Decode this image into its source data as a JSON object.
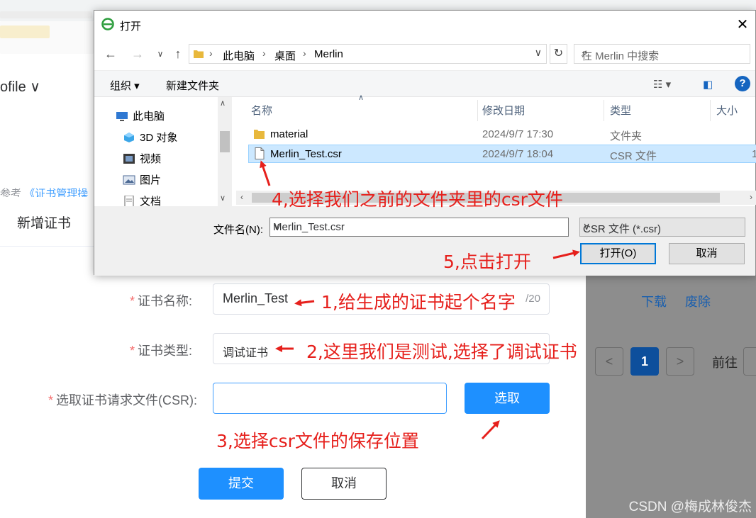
{
  "background": {
    "profile_menu": "ofile ∨",
    "breadcrumb_prefix": "参考",
    "breadcrumb_link": "《证书管理操",
    "dialog_title": "新增证书",
    "row_actions": {
      "download": "下载",
      "revoke": "废除"
    },
    "pagination": {
      "prev": "<",
      "current": "1",
      "next": ">",
      "goto_label": "前往"
    }
  },
  "form": {
    "cert_name_label": "证书名称:",
    "cert_name_value": "Merlin_Test",
    "cert_name_counter": "/20",
    "cert_type_label": "证书类型:",
    "cert_type_value": "调试证书",
    "csr_label": "选取证书请求文件(CSR):",
    "csr_value": "",
    "select_button": "选取",
    "submit_button": "提交",
    "cancel_button": "取消"
  },
  "annotations": {
    "step1": "1,给生成的证书起个名字",
    "step2": "2,这里我们是测试,选择了调试证书",
    "step3": "3,选择csr文件的保存位置",
    "step4": "4,选择我们之前的文件夹里的csr文件",
    "step5": "5,点击打开",
    "color": "#e6201c"
  },
  "watermark": "CSDN @梅成林俊杰",
  "file_dialog": {
    "title": "打开",
    "address": [
      "此电脑",
      "桌面",
      "Merlin"
    ],
    "search_placeholder": "在 Merlin 中搜索",
    "toolbar": {
      "organize": "组织 ▾",
      "new_folder": "新建文件夹",
      "help": "?"
    },
    "tree": [
      {
        "label": "此电脑",
        "icon": "computer-icon"
      },
      {
        "label": "3D 对象",
        "icon": "cube-3d-icon"
      },
      {
        "label": "视频",
        "icon": "video-icon"
      },
      {
        "label": "图片",
        "icon": "picture-icon"
      },
      {
        "label": "文档",
        "icon": "document-icon"
      }
    ],
    "columns": [
      "名称",
      "修改日期",
      "类型",
      "大小"
    ],
    "files": [
      {
        "name": "material",
        "date": "2024/9/7 17:30",
        "type": "文件夹",
        "size": "",
        "icon": "folder-icon"
      },
      {
        "name": "Merlin_Test.csr",
        "date": "2024/9/7 18:04",
        "type": "CSR 文件",
        "size": "1",
        "icon": "file-icon"
      }
    ],
    "filename_label": "文件名(N):",
    "filename_value": "Merlin_Test.csr",
    "filetype_value": "CSR 文件 (*.csr)",
    "open_button": "打开(O)",
    "cancel_button": "取消"
  },
  "colors": {
    "primary_button": "#1e90ff",
    "selection": "#cce8ff",
    "overlay": "#8d8d8d"
  }
}
